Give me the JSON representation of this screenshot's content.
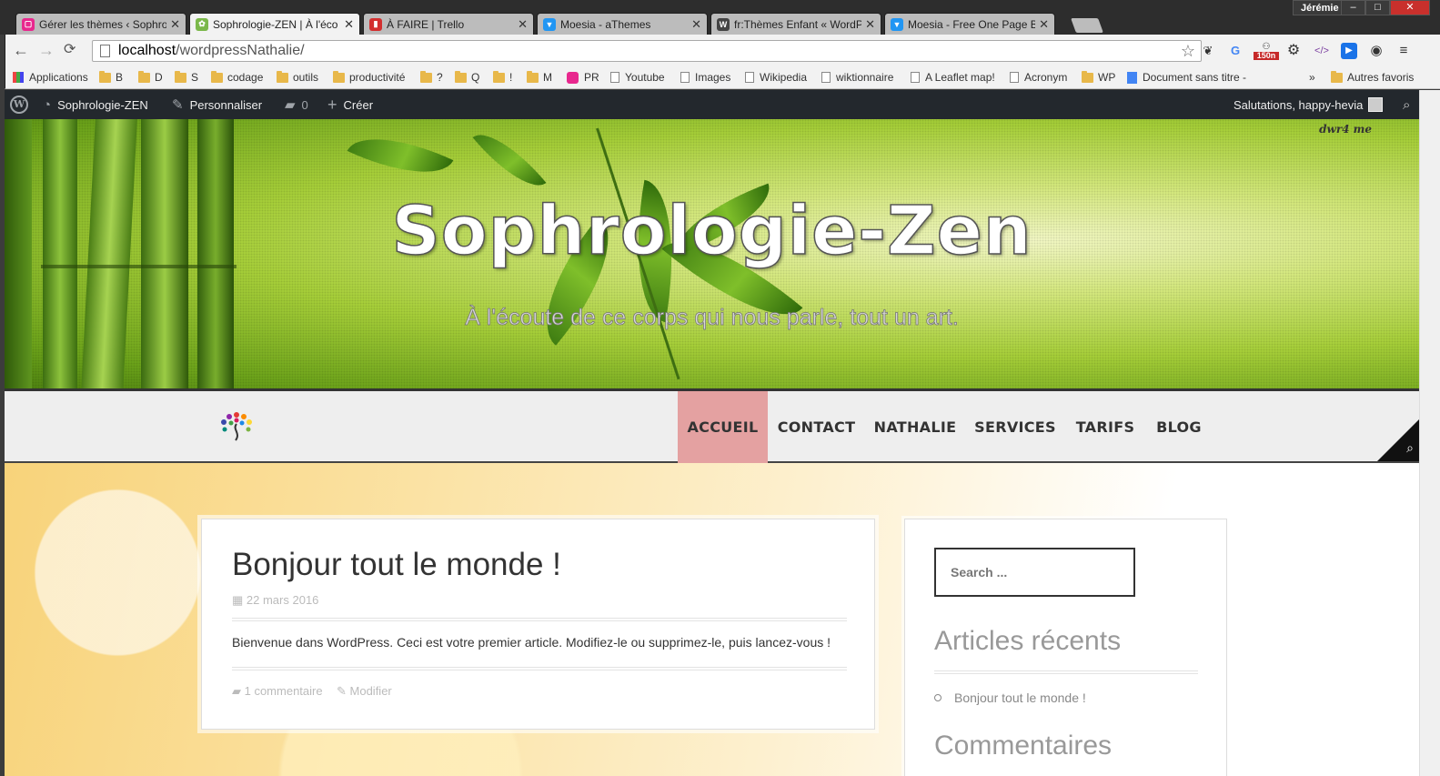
{
  "window": {
    "user": "Jérémie",
    "min": "–",
    "max": "□",
    "close": "✕"
  },
  "tabs": [
    {
      "title": "Gérer les thèmes ‹ Sophro",
      "favicon_color": "#e8288e",
      "active": false
    },
    {
      "title": "Sophrologie-ZEN | À l'éco",
      "favicon_color": "#7bb84a",
      "active": true
    },
    {
      "title": "À FAIRE | Trello",
      "favicon_color": "#d32f2f",
      "active": false
    },
    {
      "title": "Moesia - aThemes",
      "favicon_color": "#2196f3",
      "active": false
    },
    {
      "title": "fr:Thèmes Enfant « WordP",
      "favicon_color": "#444444",
      "active": false
    },
    {
      "title": "Moesia - Free One Page B",
      "favicon_color": "#2196f3",
      "active": false
    }
  ],
  "toolbar": {
    "back": "←",
    "forward": "→",
    "reload": "C",
    "url_host": "localhost",
    "url_path": "/wordpressNathalie/",
    "star": "☆"
  },
  "extensions": [
    "evernote-icon",
    "google-icon",
    "counter-icon",
    "gear-icon",
    "code-icon",
    "play-icon",
    "eye-icon",
    "menu-icon"
  ],
  "extension_badge": "150n",
  "bookmarks": [
    {
      "label": "Applications",
      "kind": "apps"
    },
    {
      "label": "B",
      "kind": "folder"
    },
    {
      "label": "D",
      "kind": "folder"
    },
    {
      "label": "S",
      "kind": "folder"
    },
    {
      "label": "codage",
      "kind": "folder"
    },
    {
      "label": "outils",
      "kind": "folder"
    },
    {
      "label": "productivité",
      "kind": "folder"
    },
    {
      "label": "?",
      "kind": "folder"
    },
    {
      "label": "Q",
      "kind": "folder"
    },
    {
      "label": "!",
      "kind": "folder"
    },
    {
      "label": "M",
      "kind": "folder"
    },
    {
      "label": "PR",
      "kind": "pr"
    },
    {
      "label": "Youtube",
      "kind": "page"
    },
    {
      "label": "Images",
      "kind": "page"
    },
    {
      "label": "Wikipedia",
      "kind": "page"
    },
    {
      "label": "wiktionnaire",
      "kind": "page"
    },
    {
      "label": "A Leaflet map!",
      "kind": "page"
    },
    {
      "label": "Acronym",
      "kind": "page"
    },
    {
      "label": "WP",
      "kind": "folder"
    },
    {
      "label": "Document sans titre -",
      "kind": "doc"
    }
  ],
  "bookmarks_more": "»",
  "bookmarks_other": "Autres favoris",
  "adminbar": {
    "site": "Sophrologie-ZEN",
    "customize": "Personnaliser",
    "comments": "0",
    "new": "Créer",
    "greeting": "Salutations, happy-hevia"
  },
  "hero": {
    "title": "Sophrologie-Zen",
    "tagline": "À l'écoute de ce corps qui nous parle, tout un art.",
    "credit": "dwr4 me"
  },
  "nav": {
    "items": [
      "ACCUEIL",
      "CONTACT",
      "NATHALIE",
      "SERVICES",
      "TARIFS",
      "BLOG"
    ],
    "active": "ACCUEIL"
  },
  "post": {
    "title": "Bonjour tout le monde !",
    "date": "22 mars 2016",
    "body": "Bienvenue dans WordPress. Ceci est votre premier article. Modifiez-le ou supprimez-le, puis lancez-vous !",
    "comments": "1 commentaire",
    "edit": "Modifier"
  },
  "sidebar": {
    "search_placeholder": "Search ...",
    "recent_title": "Articles récents",
    "recent_items": [
      "Bonjour tout le monde !"
    ],
    "comments_title": "Commentaires"
  }
}
